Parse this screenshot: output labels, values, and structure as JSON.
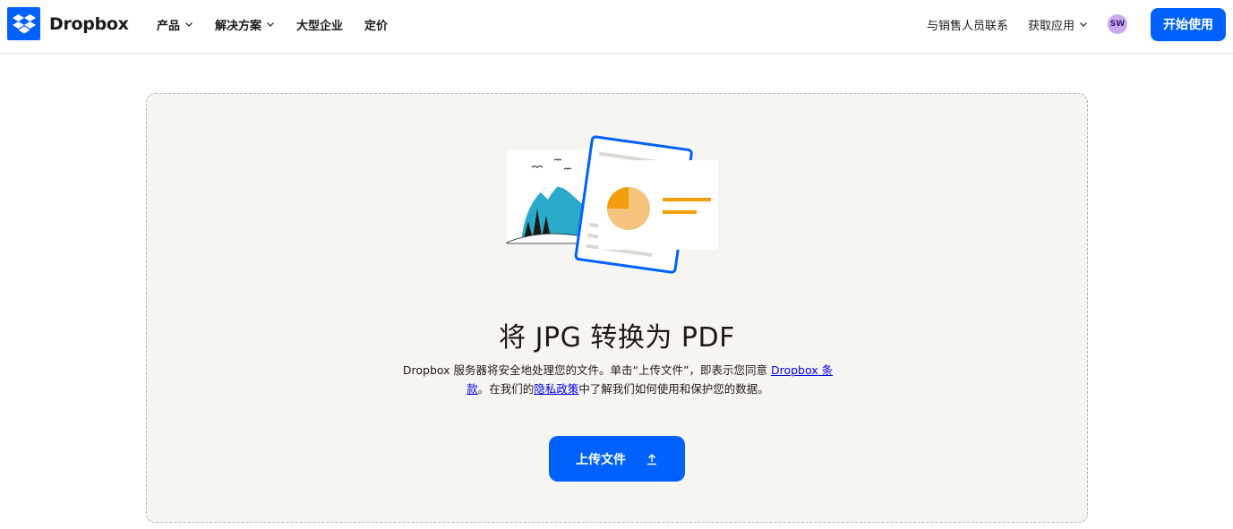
{
  "brand": {
    "name": "Dropbox",
    "color": "#0061fe"
  },
  "nav": {
    "items": [
      {
        "label": "产品",
        "has_menu": true
      },
      {
        "label": "解决方案",
        "has_menu": true
      },
      {
        "label": "大型企业",
        "has_menu": false
      },
      {
        "label": "定价",
        "has_menu": false
      }
    ],
    "contact_sales": "与销售人员联系",
    "get_app": "获取应用",
    "avatar_initials": "SW",
    "cta_label": "开始使用"
  },
  "main": {
    "title": "将 JPG 转换为 PDF",
    "desc_part1": "Dropbox 服务器将安全地处理您的文件。单击“上传文件”，即表示您同意 ",
    "terms_link": "Dropbox 条款",
    "desc_part2": "。在我们的",
    "privacy_link": "隐私政策",
    "desc_part3": "中了解我们如何使用和保护您的数据。",
    "upload_label": "上传文件"
  },
  "icons": {
    "logo": "dropbox-logo-icon",
    "chevron": "chevron-down-icon",
    "upload": "upload-arrow-icon"
  }
}
